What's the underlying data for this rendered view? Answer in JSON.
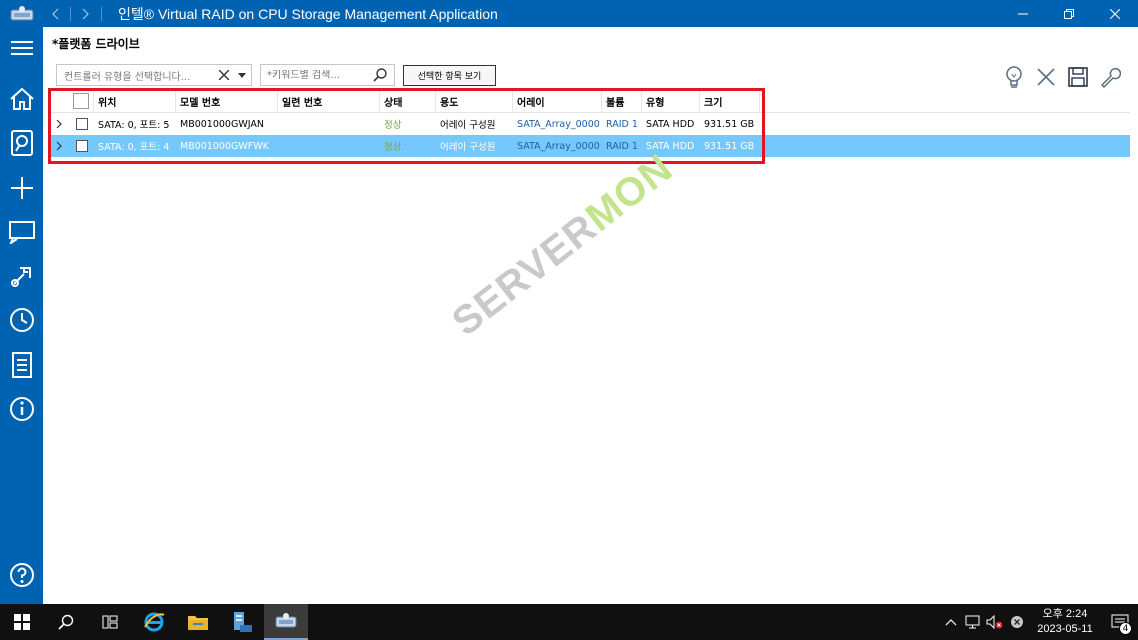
{
  "window": {
    "title": "인텔® Virtual RAID on CPU Storage Management Application"
  },
  "sidebar": {
    "items": [
      {
        "icon": "menu-icon"
      },
      {
        "icon": "home-icon"
      },
      {
        "icon": "storage-icon"
      },
      {
        "icon": "plus-icon"
      },
      {
        "icon": "monitor-icon"
      },
      {
        "icon": "tools-icon"
      },
      {
        "icon": "clock-icon"
      },
      {
        "icon": "document-icon"
      },
      {
        "icon": "info-icon"
      }
    ],
    "help_icon": "help-icon"
  },
  "main": {
    "page_title": "*플랫폼 드라이브",
    "controller_select": {
      "placeholder": "컨트롤러 유형을 선택합니다..."
    },
    "search": {
      "placeholder": "*키워드별 검색..."
    },
    "view_selected_button": "선택한 항목 보기",
    "toolbar_icons": [
      "lightbulb-icon",
      "close-icon",
      "save-icon",
      "wrench-icon"
    ]
  },
  "table": {
    "headers": {
      "location": "위치",
      "model": "모델 번호",
      "serial": "일련 번호",
      "status": "상태",
      "usage": "용도",
      "array": "어레이",
      "volume": "볼륨",
      "type": "유형",
      "size": "크기"
    },
    "rows": [
      {
        "location": "SATA: 0, 포트: 5",
        "model": "MB001000GWJAN",
        "serial": "",
        "status": "정상",
        "usage": "어레이 구성원",
        "array": "SATA_Array_0000",
        "volume": "RAID 1",
        "type": "SATA HDD",
        "size": "931.51 GB"
      },
      {
        "location": "SATA: 0, 포트: 4",
        "model": "MB001000GWFWK",
        "serial": "",
        "status": "정상",
        "usage": "어레이 구성원",
        "array": "SATA_Array_0000",
        "volume": "RAID 1",
        "type": "SATA HDD",
        "size": "931.51 GB"
      }
    ]
  },
  "watermark": {
    "part1": "SERVER",
    "part2": "MON"
  },
  "taskbar": {
    "clock_line1": "오후 2:24",
    "clock_line2": "2023-05-11",
    "notification_count": "4"
  },
  "colors": {
    "accent": "#0063b1",
    "selected_row": "#75c8fb",
    "highlight_border": "#e1171f",
    "status_ok": "#77a13a"
  }
}
